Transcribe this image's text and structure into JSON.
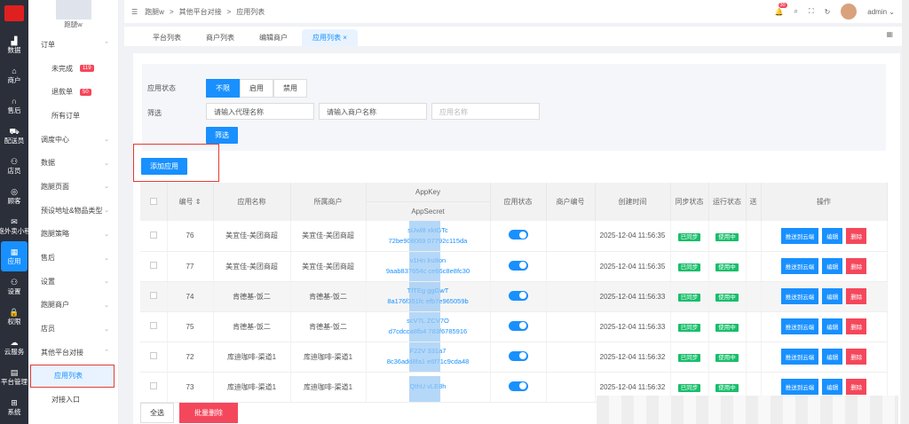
{
  "rail": [
    "数据",
    "商户",
    "售后",
    "配送员",
    "店员",
    "顾客",
    "跑外卖小程",
    "应用",
    "设置",
    "权限",
    "云服务",
    "平台管理",
    "系统"
  ],
  "rail_icons": [
    "chart-icon",
    "shop-icon",
    "headset-icon",
    "rider-icon",
    "staff-icon",
    "customer-icon",
    "wechat-icon",
    "apps-icon",
    "user-settings-icon",
    "lock-icon",
    "cloud-icon",
    "doc-icon",
    "windows-icon"
  ],
  "shop_name": "跑腿w",
  "menu": [
    {
      "label": "订单",
      "chev": "⌃"
    },
    {
      "label": "未完成",
      "badge": "119",
      "child": true
    },
    {
      "label": "退款单",
      "badge": "50",
      "child": true
    },
    {
      "label": "所有订单",
      "child": true
    },
    {
      "label": "调度中心",
      "chev": "⌄"
    },
    {
      "label": "数据",
      "chev": "⌄"
    },
    {
      "label": "跑腿页面",
      "chev": "⌄"
    },
    {
      "label": "预设地址&物品类型",
      "chev": "⌄"
    },
    {
      "label": "跑腿策略",
      "chev": "⌄"
    },
    {
      "label": "售后",
      "chev": "⌄"
    },
    {
      "label": "设置",
      "chev": "⌄"
    },
    {
      "label": "跑腿商户",
      "chev": "⌄"
    },
    {
      "label": "店员",
      "chev": "⌄"
    },
    {
      "label": "其他平台对接",
      "chev": "⌃"
    },
    {
      "label": "应用列表",
      "child": true,
      "active": true
    },
    {
      "label": "对接入口",
      "child": true
    }
  ],
  "breadcrumb": [
    "跑腿w",
    ">",
    "其他平台对接",
    ">",
    "应用列表"
  ],
  "notifications": "30",
  "user": "admin",
  "tabs": [
    "平台列表",
    "商户列表",
    "编辑商户",
    "应用列表"
  ],
  "filter": {
    "status_label": "应用状态",
    "status_options": [
      "不限",
      "启用",
      "禁用"
    ],
    "filter_label": "筛选",
    "agent_placeholder": "请输入代理名称",
    "merchant_placeholder": "请输入商户名称",
    "app_placeholder": "应用名称",
    "filter_button": "筛选"
  },
  "add_button": "添加应用",
  "columns": [
    "编号",
    "应用名称",
    "所属商户",
    "AppKey",
    "AppSecret",
    "应用状态",
    "商户编号",
    "创建时间",
    "同步状态",
    "运行状态",
    "送",
    "操作"
  ],
  "rows": [
    {
      "id": "76",
      "name": "美宜佳-美团商超",
      "merchant": "美宜佳-美团商超",
      "key": "sUwl8     xktGTc",
      "secret": "72be908069     07792c115da",
      "time": "2025-12-04 11:56:35",
      "sync": "已同步",
      "run": "使用中"
    },
    {
      "id": "77",
      "name": "美宜佳-美团商超",
      "merchant": "美宜佳-美团商超",
      "key": "v1Hn     lru9on",
      "secret": "9aab837654c     ce66c8e8fc30",
      "time": "2025-12-04 11:56:35",
      "sync": "已同步",
      "run": "使用中"
    },
    {
      "id": "74",
      "name": "肯德基-饭二",
      "merchant": "肯德基-饭二",
      "key": "TfTEg     ggGwT",
      "secret": "8a176f351fc     efb7e965059b",
      "time": "2025-12-04 11:56:33",
      "sync": "已同步",
      "run": "使用中"
    },
    {
      "id": "75",
      "name": "肯德基-饭二",
      "merchant": "肯德基-饭二",
      "key": "scV7L     ZCV7O",
      "secret": "d7cdcca8fb4     783f6785916",
      "time": "2025-12-04 11:56:33",
      "sync": "已同步",
      "run": "使用中"
    },
    {
      "id": "72",
      "name": "库迪咖啡-渠道1",
      "merchant": "库迪咖啡-渠道1",
      "key": "F22V     331a7",
      "secret": "8c36add8fa1     e6f71c9cda48",
      "time": "2025-12-04 11:56:32",
      "sync": "已同步",
      "run": "使用中"
    },
    {
      "id": "73",
      "name": "库迪咖啡-渠道1",
      "merchant": "库迪咖啡-渠道1",
      "key": "QthU     vLE8h",
      "secret": "",
      "time": "2025-12-04 11:56:32",
      "sync": "已同步",
      "run": "使用中"
    }
  ],
  "actions": [
    "推送到云端",
    "编辑",
    "删除"
  ],
  "select_all": "全选",
  "batch_delete": "批量删除"
}
